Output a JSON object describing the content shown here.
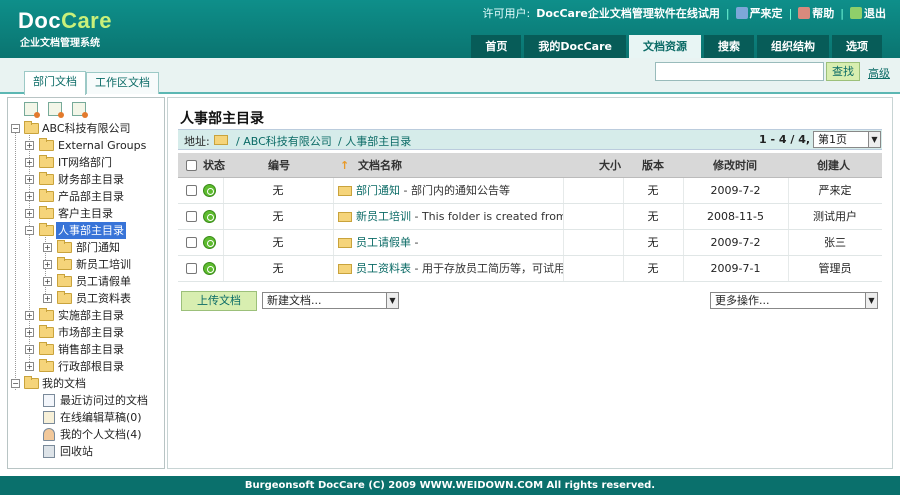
{
  "header": {
    "logo_a": "Doc",
    "logo_b": "Care",
    "logo_subtitle": "企业文档管理系统",
    "license_label": "许可用户:",
    "license_value": "DocCare企业文档管理软件在线试用",
    "user_name": "严来定",
    "help_label": "帮助",
    "logout_label": "退出"
  },
  "nav": {
    "tabs": [
      "首页",
      "我的DocCare",
      "文档资源",
      "搜索",
      "组织结构",
      "选项"
    ],
    "active": "文档资源"
  },
  "subtabs": [
    "部门文档",
    "工作区文档"
  ],
  "search": {
    "placeholder": "",
    "button": "查找",
    "advanced": "高级"
  },
  "tree": {
    "root": "ABC科技有限公司",
    "items": [
      "External Groups",
      "IT网络部门",
      "财务部主目录",
      "产品部主目录",
      "客户主目录",
      "人事部主目录"
    ],
    "selected": "人事部主目录",
    "sub_items": [
      "部门通知",
      "新员工培训",
      "员工请假单",
      "员工资料表"
    ],
    "items_after": [
      "实施部主目录",
      "市场部主目录",
      "销售部主目录",
      "行政部根目录"
    ],
    "my_docs": "我的文档",
    "my_docs_items": [
      "最近访问过的文档",
      "在线编辑草稿(0)",
      "我的个人文档(4)",
      "回收站"
    ]
  },
  "main": {
    "title": "人事部主目录",
    "path_label": "地址:",
    "crumb1": "/ ABC科技有限公司",
    "crumb2": "/ 人事部主目录",
    "range": "1 - 4 / 4,",
    "page_select": "第1页",
    "columns": {
      "status": "状态",
      "number": "编号",
      "name": "文档名称",
      "size": "大小",
      "version": "版本",
      "modified": "修改时间",
      "creator": "创建人"
    },
    "rows": [
      {
        "number": "无",
        "name": "部门通知",
        "desc": " - 部门内的通知公告等",
        "size": "",
        "version": "无",
        "modified": "2009-7-2",
        "creator": "严来定"
      },
      {
        "number": "无",
        "name": "新员工培训",
        "desc": " - This folder is created from ba",
        "size": "",
        "version": "无",
        "modified": "2008-11-5",
        "creator": "测试用户"
      },
      {
        "number": "无",
        "name": "员工请假单",
        "desc": " -",
        "size": "",
        "version": "无",
        "modified": "2009-7-2",
        "creator": "张三"
      },
      {
        "number": "无",
        "name": "员工资料表",
        "desc": " - 用于存放员工简历等，可试用",
        "size": "",
        "version": "无",
        "modified": "2009-7-1",
        "creator": "管理员"
      }
    ],
    "upload_button": "上传文档",
    "new_doc_select": "新建文档...",
    "more_ops_select": "更多操作..."
  },
  "footer": {
    "text": "Burgeonsoft DocCare (C) 2009 WWW.WEIDOWN.COM All rights reserved."
  },
  "colors": {
    "brand": "#0a7470",
    "accent": "#c9f07a",
    "selection": "#3874d8"
  }
}
